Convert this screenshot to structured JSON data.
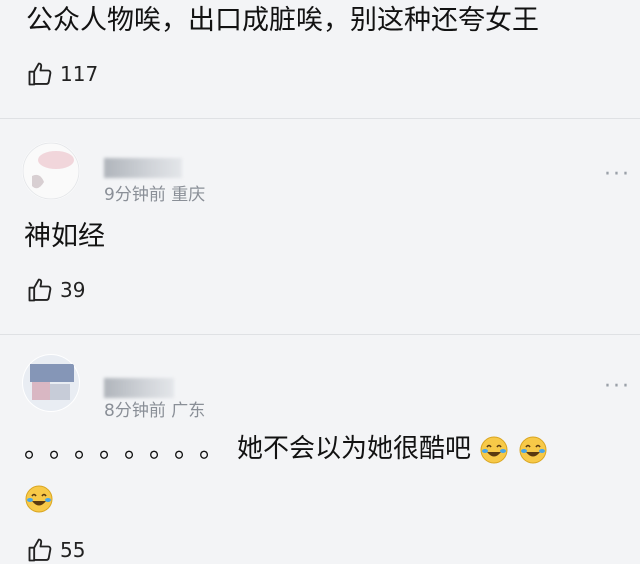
{
  "comment1": {
    "text": "公众人物唉，出口成脏唉，别这种还夸女王",
    "likes": "117"
  },
  "comment2": {
    "meta": "9分钟前 重庆",
    "text": "神如经",
    "likes": "39",
    "more": "···"
  },
  "comment3": {
    "meta": "8分钟前 广东",
    "dots": "。。。。。。。。",
    "text": "她不会以为她很酷吧",
    "likes": "55",
    "more": "···",
    "emoji_icon": "laughing-tears-emoji"
  }
}
